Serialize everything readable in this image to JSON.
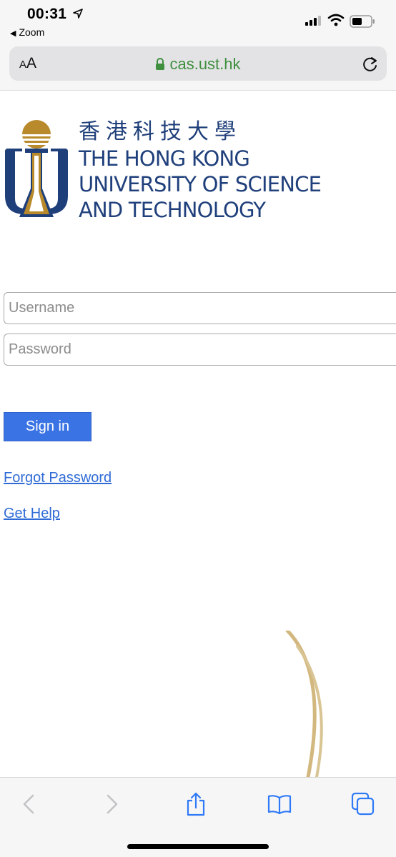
{
  "status_bar": {
    "time": "00:31",
    "back_app": "Zoom"
  },
  "address_bar": {
    "text_size_label": "AA",
    "url": "cas.ust.hk"
  },
  "logo": {
    "chinese_name": "香港科技大學",
    "english_line1": "THE HONG KONG",
    "english_line2": "UNIVERSITY OF SCIENCE",
    "english_line3": "AND TECHNOLOGY"
  },
  "login_form": {
    "username_placeholder": "Username",
    "username_value": "",
    "password_placeholder": "Password",
    "password_value": "",
    "sign_in_label": "Sign in"
  },
  "links": {
    "forgot_password": "Forgot Password",
    "get_help": "Get Help"
  },
  "toolbar": {
    "icons": [
      "back-icon",
      "forward-icon",
      "share-icon",
      "bookmarks-icon",
      "tabs-icon"
    ]
  },
  "colors": {
    "url_green": "#3f8f3f",
    "brand_blue": "#1f3f7a",
    "brand_gold": "#b98a2c",
    "button_blue": "#3a73e4",
    "link_blue": "#2f6bd6",
    "ios_blue": "#2f7af6"
  }
}
